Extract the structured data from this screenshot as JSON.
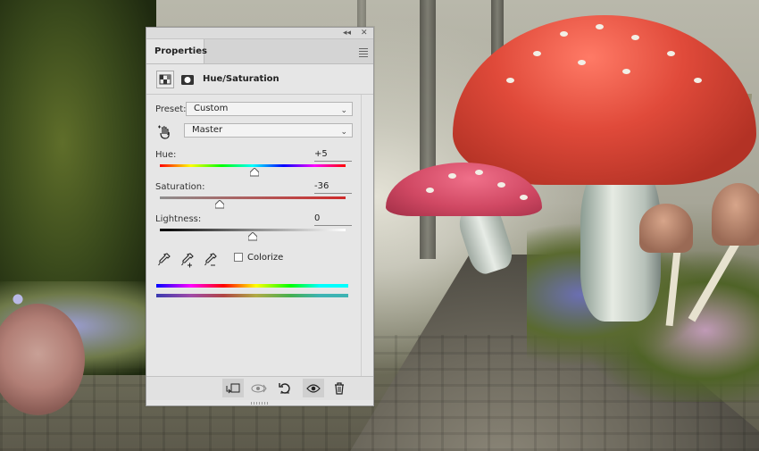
{
  "panel": {
    "tab_label": "Properties",
    "adjustment_title": "Hue/Saturation",
    "preset_label": "Preset:",
    "preset_value": "Custom",
    "channel_value": "Master",
    "hue": {
      "label": "Hue:",
      "value": "+5",
      "fraction": 0.51
    },
    "saturation": {
      "label": "Saturation:",
      "value": "-36",
      "fraction": 0.32
    },
    "lightness": {
      "label": "Lightness:",
      "value": "0",
      "fraction": 0.5
    },
    "colorize_label": "Colorize",
    "colorize_checked": false
  },
  "icons": {
    "collapse": "double-chevron-icon",
    "close": "close-icon",
    "menu": "panel-menu-icon",
    "adjustment": "adjustment-layer-icon",
    "mask": "layer-mask-icon",
    "targeted": "targeted-adjustment-hand-icon",
    "eyedropper": "eyedropper-icon",
    "eyedropper_add": "eyedropper-plus-icon",
    "eyedropper_sub": "eyedropper-minus-icon",
    "clip": "clip-to-layer-icon",
    "view_previous": "view-previous-state-icon",
    "reset": "reset-icon",
    "visibility": "eye-icon",
    "delete": "trash-icon"
  },
  "colors": {
    "panel_bg": "#e6e6e6",
    "hue_gradient": [
      "#ff0000",
      "#ffff00",
      "#00ff00",
      "#00ffff",
      "#0000ff",
      "#ff00ff",
      "#ff0000"
    ]
  }
}
